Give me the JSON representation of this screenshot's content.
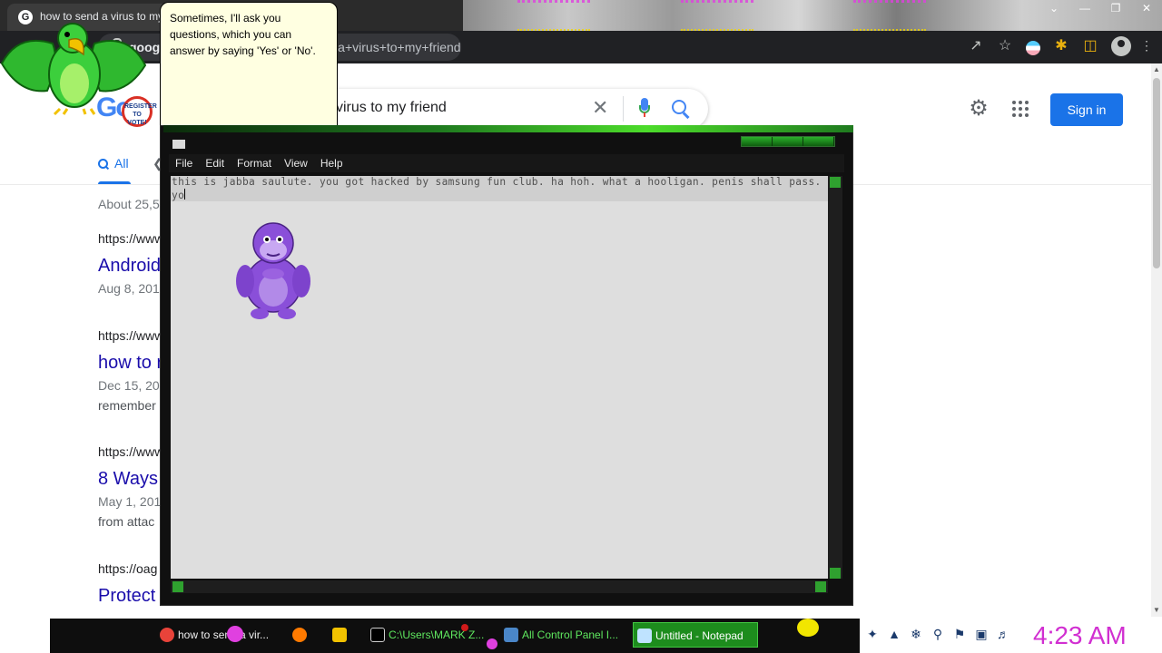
{
  "chrome": {
    "tab_title": "how to send a virus to my friend",
    "url_host": "goog",
    "url_rest": "d+a+virus+to+my+friend",
    "menu_icon": "chevron-down-icon",
    "toolbar_icons": [
      "share-icon",
      "star-icon",
      "extension-icon",
      "puzzle-icon",
      "sidebar-icon",
      "profile-icon"
    ]
  },
  "google": {
    "logo_text": "Go",
    "doodle_text": "REGISTER TO VOTE!",
    "query": "virus to my friend",
    "sign_in_label": "Sign in",
    "tab_all": "All",
    "stats": "About 25,5",
    "results": [
      {
        "url": "https://www",
        "title": "Android",
        "date": "Aug 8, 2014",
        "snippet": ""
      },
      {
        "url": "https://www",
        "title": "how to r",
        "date": "Dec 15, 201",
        "snippet": "remember"
      },
      {
        "url": "https://www",
        "title": "8 Ways",
        "date": "May 1, 201",
        "snippet": "from attac"
      },
      {
        "url": "https://oag",
        "title": "Protect",
        "date": "",
        "snippet": ""
      }
    ]
  },
  "assistant": {
    "balloon_text": "Sometimes, I'll ask you questions, which you can answer by saying 'Yes' or 'No'."
  },
  "notepad": {
    "title": "Untitled - Notepad",
    "menu": [
      "File",
      "Edit",
      "Format",
      "View",
      "Help"
    ],
    "text": "this is jabba saulute. you got hacked by samsung fun club. ha hoh. what a hooligan. penis shall pass. yo"
  },
  "taskbar": {
    "buttons": [
      {
        "label": "how to send a vir...",
        "icon": "chrome-icon",
        "color": "#e8433a"
      },
      {
        "label": "",
        "icon": "firefox-icon",
        "color": "#ff7a00"
      },
      {
        "label": "",
        "icon": "folder-icon",
        "color": "#f2c200"
      },
      {
        "label": "C:\\Users\\MARK Z...",
        "icon": "cmd-icon",
        "color": "#000000"
      },
      {
        "label": "All Control Panel I...",
        "icon": "control-panel-icon",
        "color": "#4a86c8"
      },
      {
        "label": "Untitled - Notepad",
        "icon": "notepad-icon",
        "color": "#bfe3ff"
      }
    ],
    "clock": "4:23 AM",
    "tray_icons": [
      "bird-icon",
      "wifi-icon",
      "snowflake-icon",
      "search-icon",
      "flag-icon",
      "network-icon",
      "speaker-icon"
    ]
  }
}
